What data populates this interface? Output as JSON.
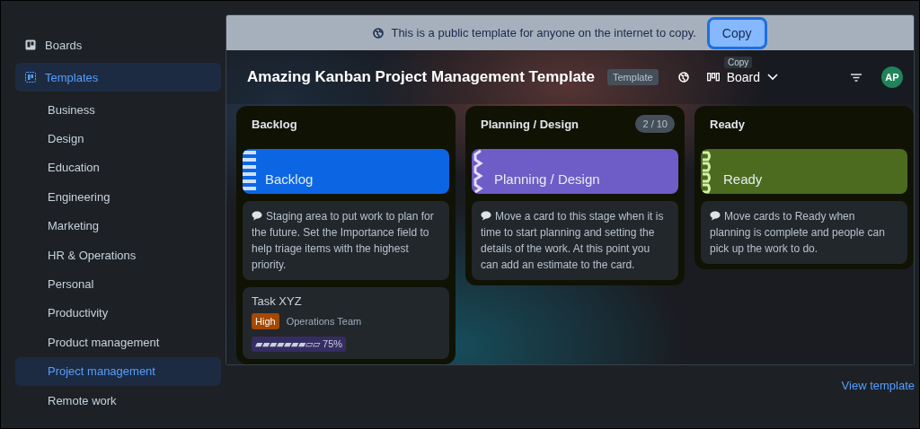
{
  "sidebar": {
    "items": [
      {
        "label": "Boards",
        "selected": false
      },
      {
        "label": "Templates",
        "selected": true,
        "children": [
          {
            "label": "Business",
            "selected": false
          },
          {
            "label": "Design",
            "selected": false
          },
          {
            "label": "Education",
            "selected": false
          },
          {
            "label": "Engineering",
            "selected": false
          },
          {
            "label": "Marketing",
            "selected": false
          },
          {
            "label": "HR & Operations",
            "selected": false
          },
          {
            "label": "Personal",
            "selected": false
          },
          {
            "label": "Productivity",
            "selected": false
          },
          {
            "label": "Product management",
            "selected": false
          },
          {
            "label": "Project management",
            "selected": true
          },
          {
            "label": "Remote work",
            "selected": false
          }
        ]
      }
    ]
  },
  "banner": {
    "text": "This is a public template for anyone on the internet to copy.",
    "button": "Copy",
    "tooltip": "Copy"
  },
  "board": {
    "title": "Amazing Kanban Project Management Template",
    "badge": "Template",
    "view": "Board",
    "avatar": "AP",
    "columns": [
      {
        "title": "Backlog",
        "cover": {
          "title": "Backlog",
          "color": "#0c66e4"
        },
        "cards": [
          {
            "kind": "note",
            "text": "Staging area to put work to plan for the future. Set the Importance field to help triage items with the highest priority."
          },
          {
            "kind": "task",
            "title": "Task XYZ",
            "label": "High",
            "team": "Operations Team",
            "progress": "▰▰▰▰▰▰▰▱▱ 75%"
          }
        ]
      },
      {
        "title": "Planning / Design",
        "count": "2 / 10",
        "cover": {
          "title": "Planning / Design",
          "color": "#6e5dc6"
        },
        "cards": [
          {
            "kind": "note",
            "text": "Move a card to this stage when it is time to start planning and setting the details of the work. At this point you can add an estimate to the card."
          }
        ]
      },
      {
        "title": "Ready",
        "cover": {
          "title": "Ready",
          "color": "#4c6b1f"
        },
        "cards": [
          {
            "kind": "note",
            "text": "Move cards to Ready when planning is complete and people can pick up the work to do."
          }
        ]
      }
    ]
  },
  "footer": {
    "link": "View template"
  }
}
